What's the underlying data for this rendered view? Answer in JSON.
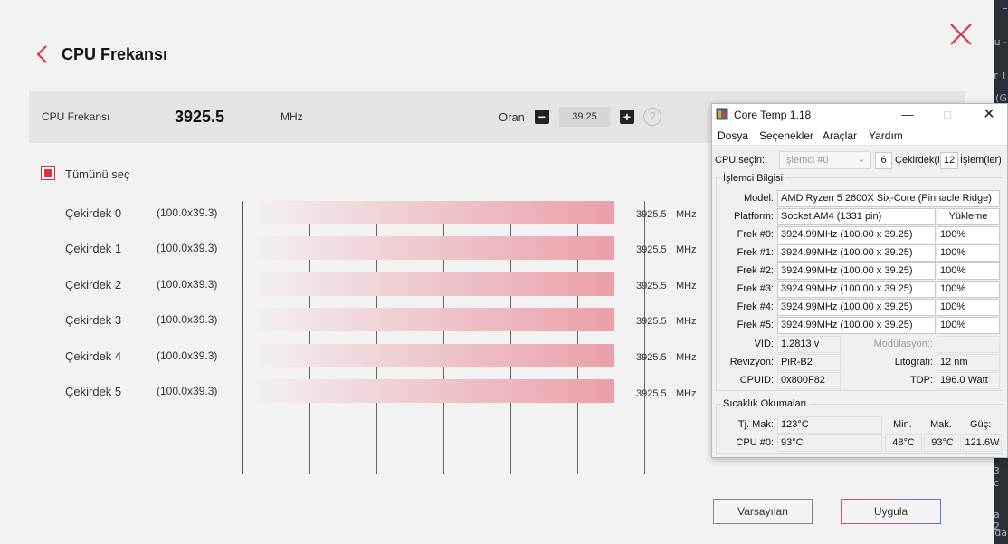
{
  "page": {
    "title": "CPU Frekansı",
    "frequency_label": "CPU Frekansı",
    "frequency_value": "3925.5",
    "frequency_unit": "MHz",
    "ratio_label": "Oran",
    "ratio_value": "39.25",
    "minus_label": "−",
    "plus_label": "+",
    "help_label": "?",
    "select_all_label": "Tümünü seç",
    "default_button": "Varsayılan",
    "apply_button": "Uygula",
    "cores": [
      {
        "name": "Çekirdek 0",
        "ratio": "(100.0x39.3)",
        "value": "3925.5",
        "unit": "MHz"
      },
      {
        "name": "Çekirdek 1",
        "ratio": "(100.0x39.3)",
        "value": "3925.5",
        "unit": "MHz"
      },
      {
        "name": "Çekirdek 2",
        "ratio": "(100.0x39.3)",
        "value": "3925.5",
        "unit": "MHz"
      },
      {
        "name": "Çekirdek 3",
        "ratio": "(100.0x39.3)",
        "value": "3925.5",
        "unit": "MHz"
      },
      {
        "name": "Çekirdek 4",
        "ratio": "(100.0x39.3)",
        "value": "3925.5",
        "unit": "MHz"
      },
      {
        "name": "Çekirdek 5",
        "ratio": "(100.0x39.3)",
        "value": "3925.5",
        "unit": "MHz"
      }
    ]
  },
  "coretemp": {
    "title": "Core Temp 1.18",
    "menu": [
      "Dosya",
      "Seçenekler",
      "Araçlar",
      "Yardım"
    ],
    "cpu_select_label": "CPU seçin:",
    "cpu_select_value": "İşlemci #0",
    "cores_count": "6",
    "cores_label": "Çekirdek(le",
    "threads_count": "12",
    "threads_label": "İşlem(ler)",
    "info_group": "İşlemci Bilgisi",
    "model_label": "Model:",
    "model_value": "AMD Ryzen 5 2600X Six-Core (Pinnacle Ridge)",
    "platform_label": "Platform:",
    "platform_value": "Socket AM4 (1331 pin)",
    "load_header": "Yükleme",
    "freqs": [
      {
        "label": "Frek #0:",
        "value": "3924.99MHz (100.00 x 39.25)",
        "load": "100%"
      },
      {
        "label": "Frek #1:",
        "value": "3924.99MHz (100.00 x 39.25)",
        "load": "100%"
      },
      {
        "label": "Frek #2:",
        "value": "3924.99MHz (100.00 x 39.25)",
        "load": "100%"
      },
      {
        "label": "Frek #3:",
        "value": "3924.99MHz (100.00 x 39.25)",
        "load": "100%"
      },
      {
        "label": "Frek #4:",
        "value": "3924.99MHz (100.00 x 39.25)",
        "load": "100%"
      },
      {
        "label": "Frek #5:",
        "value": "3924.99MHz (100.00 x 39.25)",
        "load": "100%"
      }
    ],
    "vid_label": "VID:",
    "vid_value": "1.2813 v",
    "modulation_label": "Modülasyon::",
    "modulation_value": "",
    "revision_label": "Revizyon:",
    "revision_value": "PiR-B2",
    "litho_label": "Litografi:",
    "litho_value": "12 nm",
    "cpuid_label": "CPUID:",
    "cpuid_value": "0x800F82",
    "tdp_label": "TDP:",
    "tdp_value": "196.0 Watt",
    "temp_group": "Sıcaklık Okumaları",
    "tjmax_label": "Tj. Mak:",
    "tjmax_value": "123°C",
    "min_header": "Min.",
    "max_header": "Mak.",
    "power_header": "Güç:",
    "cpu0_label": "CPU #0:",
    "cpu0_temp": "93°C",
    "cpu0_min": "48°C",
    "cpu0_max": "93°C",
    "cpu0_power": "121.6W"
  },
  "background": {
    "edge_fragments": [
      "L",
      "u -",
      "r T",
      "(G",
      "3 c",
      "a 2",
      "da"
    ]
  },
  "colors": {
    "accent_red": "#e03040",
    "bar_end": "#ec9fa9",
    "band_bg": "#e4e4e6"
  }
}
